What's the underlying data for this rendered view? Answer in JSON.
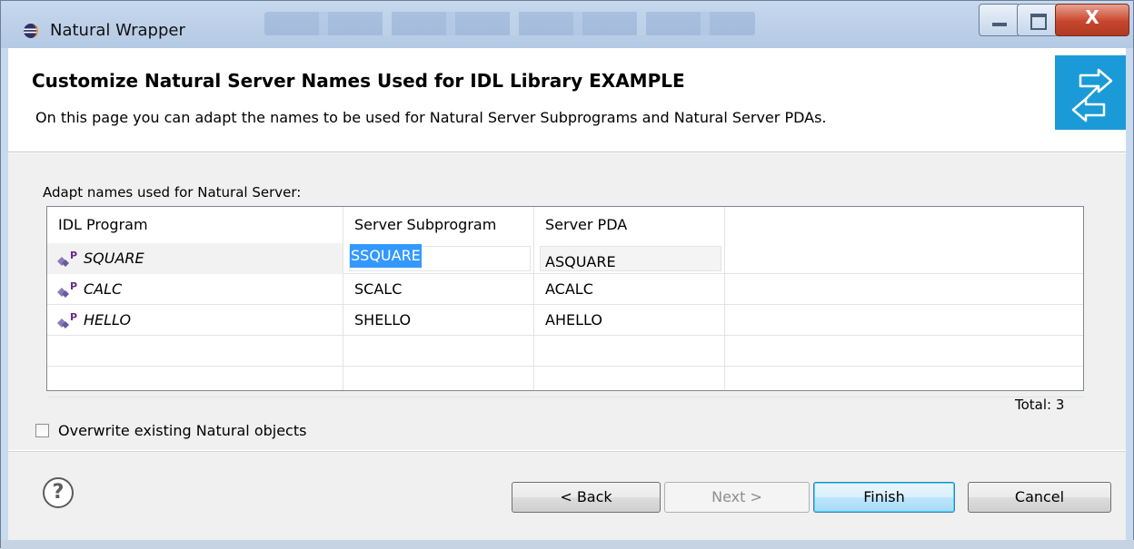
{
  "window": {
    "title": "Natural Wrapper"
  },
  "header": {
    "title": "Customize Natural Server Names Used for IDL Library EXAMPLE",
    "description": "On this page you can adapt the names to be used for Natural Server Subprograms and Natural Server PDAs."
  },
  "table": {
    "label": "Adapt names used for Natural Server:",
    "columns": [
      "IDL Program",
      "Server Subprogram",
      "Server PDA"
    ],
    "rows": [
      {
        "program": "SQUARE",
        "subprogram": "SSQUARE",
        "pda": "ASQUARE"
      },
      {
        "program": "CALC",
        "subprogram": "SCALC",
        "pda": "ACALC"
      },
      {
        "program": "HELLO",
        "subprogram": "SHELLO",
        "pda": "AHELLO"
      }
    ],
    "total": "Total: 3"
  },
  "options": {
    "overwrite_label": "Overwrite existing Natural objects",
    "overwrite_checked": false
  },
  "buttons": {
    "back": "< Back",
    "next": "Next >",
    "finish": "Finish",
    "cancel": "Cancel",
    "help": "?"
  },
  "icons": {
    "app": "eclipse-icon",
    "banner": "wrapper-arrows-icon",
    "program": "idl-program-icon",
    "close_glyph": "X"
  },
  "colors": {
    "banner": "#1a9bd7",
    "selection": "#3399ff",
    "default_button": "#3c7fb1"
  }
}
